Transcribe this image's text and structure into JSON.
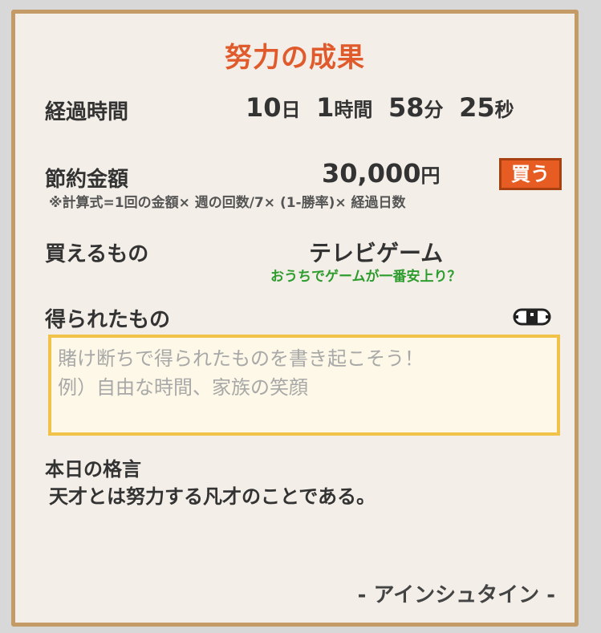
{
  "title": "努力の成果",
  "elapsed": {
    "label": "経過時間",
    "days": "10",
    "days_unit": "日",
    "hours": "1",
    "hours_unit": "時間",
    "minutes": "58",
    "minutes_unit": "分",
    "seconds": "25",
    "seconds_unit": "秒"
  },
  "savings": {
    "label": "節約金額",
    "amount": "30,000",
    "currency": "円",
    "formula": "※計算式=1回の金額× 週の回数/7× (1-勝率)× 経過日数",
    "buy_label": "買う",
    "buy_color": "#e65c22"
  },
  "purchasable": {
    "label": "買えるもの",
    "item": "テレビゲーム",
    "note": "おうちでゲームが一番安上り？",
    "note_color": "#2e9c2e"
  },
  "gained": {
    "label": "得られたもの",
    "toggle_icon": "eye-icon",
    "placeholder": "賭け断ちで得られたものを書き起こそう！\n例）自由な時間、家族の笑顔"
  },
  "motto": {
    "label": "本日の格言",
    "quote": "天才とは努力する凡才のことである。",
    "author": "- アインシュタイン -"
  },
  "colors": {
    "accent": "#e05a2b",
    "frame": "#c49a67",
    "background": "#f3efe8",
    "textarea_border": "#f0c24a"
  }
}
